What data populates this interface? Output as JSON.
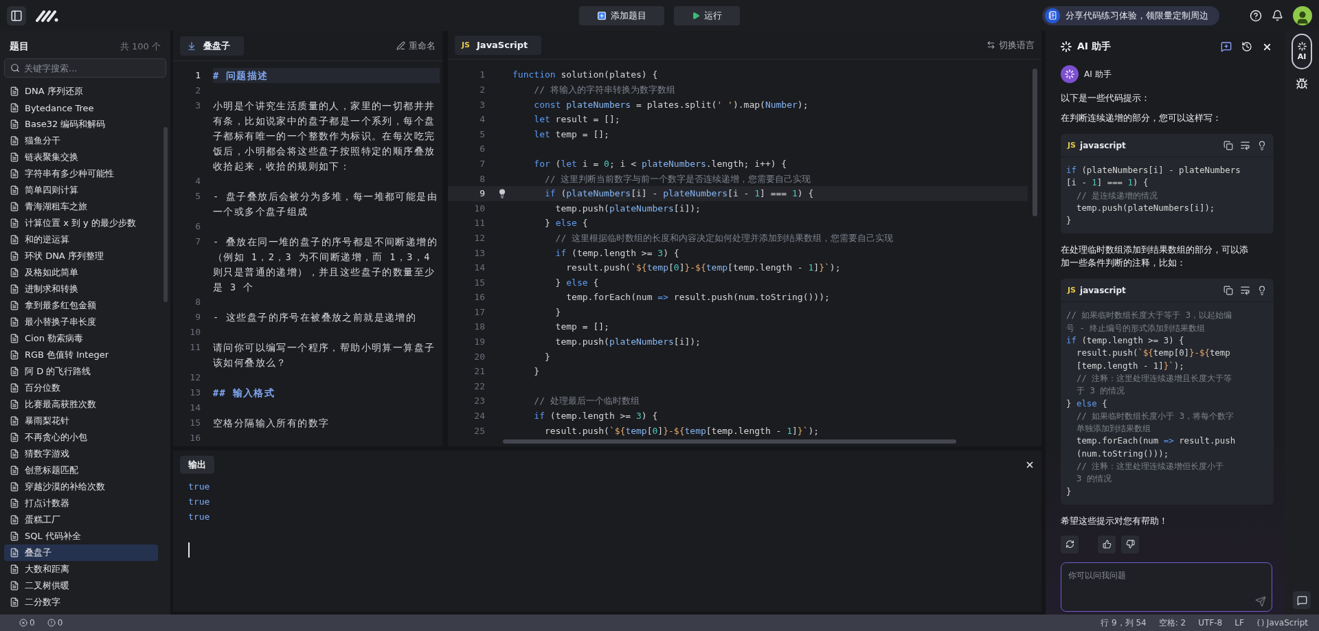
{
  "topbar": {
    "add_button": "添加题目",
    "run_button": "运行",
    "promo": "分享代码练习体验，领限量定制周边"
  },
  "sidebar": {
    "title": "题目",
    "count": "共 100 个",
    "search": {
      "placeholder": "关键字搜索..."
    },
    "items": [
      {
        "label": "DNA 序列还原",
        "selected": false
      },
      {
        "label": "Bytedance Tree",
        "selected": false
      },
      {
        "label": "Base32 编码和解码",
        "selected": false
      },
      {
        "label": "猫鱼分干",
        "selected": false
      },
      {
        "label": "链表聚集交换",
        "selected": false
      },
      {
        "label": "字符串有多少种可能性",
        "selected": false
      },
      {
        "label": "简单四则计算",
        "selected": false
      },
      {
        "label": "青海湖租车之旅",
        "selected": false
      },
      {
        "label": "计算位置 x 到 y 的最少步数",
        "selected": false
      },
      {
        "label": "和的逆运算",
        "selected": false
      },
      {
        "label": "环状 DNA 序列整理",
        "selected": false
      },
      {
        "label": "及格如此简单",
        "selected": false
      },
      {
        "label": "进制求和转换",
        "selected": false
      },
      {
        "label": "拿到最多红包金额",
        "selected": false
      },
      {
        "label": "最小替换子串长度",
        "selected": false
      },
      {
        "label": "Cion 勒索病毒",
        "selected": false
      },
      {
        "label": "RGB 色值转 Integer",
        "selected": false
      },
      {
        "label": "阿 D 的飞行路线",
        "selected": false
      },
      {
        "label": "百分位数",
        "selected": false
      },
      {
        "label": "比赛最高获胜次数",
        "selected": false
      },
      {
        "label": "暴雨梨花针",
        "selected": false
      },
      {
        "label": "不再贪心的小包",
        "selected": false
      },
      {
        "label": "猜数字游戏",
        "selected": false
      },
      {
        "label": "创意标题匹配",
        "selected": false
      },
      {
        "label": "穿越沙漠的补给次数",
        "selected": false
      },
      {
        "label": "打点计数器",
        "selected": false
      },
      {
        "label": "蛋糕工厂",
        "selected": false
      },
      {
        "label": "SQL 代码补全",
        "selected": false
      },
      {
        "label": "叠盘子",
        "selected": true
      },
      {
        "label": "大数和距离",
        "selected": false
      },
      {
        "label": "二叉树供暖",
        "selected": false
      },
      {
        "label": "二分数字",
        "selected": false
      }
    ]
  },
  "problem": {
    "title": "叠盘子",
    "rename": "重命名",
    "lines": [
      {
        "number": "1",
        "kind": "heading",
        "current": true,
        "rows": [
          "# 问题描述"
        ]
      },
      {
        "number": "2",
        "kind": "blank",
        "current": false
      },
      {
        "number": "3",
        "kind": "text",
        "current": false,
        "rows": [
          "小明是个讲究生活质量的人，家里的一切都井井",
          "有条，比如说家中的盘子都是一个系列，每个盘",
          "子都标有唯一的一个整数作为标识。在每次吃完",
          "饭后，小明都会将这些盘子按照特定的顺序叠放",
          "收拾起来，收拾的规则如下："
        ]
      },
      {
        "number": "4",
        "kind": "blank",
        "current": false
      },
      {
        "number": "5",
        "kind": "text",
        "current": false,
        "rows": [
          "- 盘子叠放后会被分为多堆，每一堆都可能是由",
          "一个或多个盘子组成"
        ]
      },
      {
        "number": "6",
        "kind": "blank",
        "current": false
      },
      {
        "number": "7",
        "kind": "text",
        "current": false,
        "rows": [
          "- 叠放在同一堆的盘子的序号都是不间断递增的",
          "（例如 1，2，3 为不间断递增，而 1，3，4",
          "则只是普通的递增），并且这些盘子的数量至少",
          "是 3 个"
        ]
      },
      {
        "number": "8",
        "kind": "blank",
        "current": false
      },
      {
        "number": "9",
        "kind": "text",
        "current": false,
        "rows": [
          "- 这些盘子的序号在被叠放之前就是递增的"
        ]
      },
      {
        "number": "10",
        "kind": "blank",
        "current": false
      },
      {
        "number": "11",
        "kind": "text",
        "current": false,
        "rows": [
          "请问你可以编写一个程序，帮助小明算一算盘子",
          "该如何叠放么？"
        ]
      },
      {
        "number": "12",
        "kind": "blank",
        "current": false
      },
      {
        "number": "13",
        "kind": "heading",
        "current": false,
        "rows": [
          "## 输入格式"
        ]
      },
      {
        "number": "14",
        "kind": "blank",
        "current": false
      },
      {
        "number": "15",
        "kind": "text",
        "current": false,
        "rows": [
          "空格分隔输入所有的数字"
        ]
      },
      {
        "number": "16",
        "kind": "blank",
        "current": false
      }
    ]
  },
  "editor": {
    "badge": "JS",
    "language": "JavaScript",
    "switch": "切换语言",
    "lines": [
      {
        "number": "1",
        "current": false,
        "tokens": [
          {
            "kind": "k",
            "text": "function"
          },
          {
            "kind": "p",
            "text": " solution(plates) {"
          }
        ]
      },
      {
        "number": "2",
        "current": false,
        "tokens": [
          {
            "kind": "c",
            "text": "    // 将输入的字符串转换为数字数组"
          }
        ]
      },
      {
        "number": "3",
        "current": false,
        "tokens": [
          {
            "kind": "k",
            "text": "    const"
          },
          {
            "kind": "v",
            "text": " plateNumbers"
          },
          {
            "kind": "p",
            "text": " = plates.split("
          },
          {
            "kind": "s",
            "text": "' '"
          },
          {
            "kind": "p",
            "text": ").map("
          },
          {
            "kind": "v",
            "text": "Number"
          },
          {
            "kind": "p",
            "text": ");"
          }
        ]
      },
      {
        "number": "4",
        "current": false,
        "tokens": [
          {
            "kind": "k",
            "text": "    let"
          },
          {
            "kind": "p",
            "text": " result = [];"
          }
        ]
      },
      {
        "number": "5",
        "current": false,
        "tokens": [
          {
            "kind": "k",
            "text": "    let"
          },
          {
            "kind": "p",
            "text": " temp = [];"
          }
        ]
      },
      {
        "number": "6",
        "current": false
      },
      {
        "number": "7",
        "current": false,
        "tokens": [
          {
            "kind": "k",
            "text": "    for"
          },
          {
            "kind": "p",
            "text": " ("
          },
          {
            "kind": "k",
            "text": "let"
          },
          {
            "kind": "p",
            "text": " i = "
          },
          {
            "kind": "n",
            "text": "0"
          },
          {
            "kind": "p",
            "text": "; i < "
          },
          {
            "kind": "v",
            "text": "plateNumbers"
          },
          {
            "kind": "p",
            "text": ".length; i++) {"
          }
        ]
      },
      {
        "number": "8",
        "current": false,
        "tokens": [
          {
            "kind": "c",
            "text": "      // 这里判断当前数字与前一个数字是否连续递增，您需要自己实现"
          }
        ]
      },
      {
        "number": "9",
        "current": true,
        "tokens": [
          {
            "kind": "k",
            "text": "      if"
          },
          {
            "kind": "p",
            "text": " ("
          },
          {
            "kind": "v",
            "text": "plateNumbers"
          },
          {
            "kind": "p",
            "text": "[i] - "
          },
          {
            "kind": "v",
            "text": "plateNumbers"
          },
          {
            "kind": "p",
            "text": "[i - "
          },
          {
            "kind": "n",
            "text": "1"
          },
          {
            "kind": "p",
            "text": "] === "
          },
          {
            "kind": "n",
            "text": "1"
          },
          {
            "kind": "p",
            "text": ") {"
          }
        ]
      },
      {
        "number": "10",
        "current": false,
        "tokens": [
          {
            "kind": "p",
            "text": "        temp.push("
          },
          {
            "kind": "v",
            "text": "plateNumbers"
          },
          {
            "kind": "p",
            "text": "[i]);"
          }
        ]
      },
      {
        "number": "11",
        "current": false,
        "tokens": [
          {
            "kind": "p",
            "text": "      } "
          },
          {
            "kind": "k",
            "text": "else"
          },
          {
            "kind": "p",
            "text": " {"
          }
        ]
      },
      {
        "number": "12",
        "current": false,
        "tokens": [
          {
            "kind": "c",
            "text": "        // 这里根据临时数组的长度和内容决定如何处理并添加到结果数组，您需要自己实现"
          }
        ]
      },
      {
        "number": "13",
        "current": false,
        "tokens": [
          {
            "kind": "k",
            "text": "        if"
          },
          {
            "kind": "p",
            "text": " (temp.length >= "
          },
          {
            "kind": "n",
            "text": "3"
          },
          {
            "kind": "p",
            "text": ") {"
          }
        ]
      },
      {
        "number": "14",
        "current": false,
        "tokens": [
          {
            "kind": "p",
            "text": "          result.push("
          },
          {
            "kind": "s",
            "text": "`${"
          },
          {
            "kind": "v",
            "text": "temp"
          },
          {
            "kind": "p",
            "text": "["
          },
          {
            "kind": "n",
            "text": "0"
          },
          {
            "kind": "p",
            "text": "]"
          },
          {
            "kind": "s",
            "text": "}-${"
          },
          {
            "kind": "v",
            "text": "temp"
          },
          {
            "kind": "p",
            "text": "[temp.length - "
          },
          {
            "kind": "n",
            "text": "1"
          },
          {
            "kind": "p",
            "text": "]"
          },
          {
            "kind": "s",
            "text": "}`"
          },
          {
            "kind": "p",
            "text": ");"
          }
        ]
      },
      {
        "number": "15",
        "current": false,
        "tokens": [
          {
            "kind": "p",
            "text": "        } "
          },
          {
            "kind": "k",
            "text": "else"
          },
          {
            "kind": "p",
            "text": " {"
          }
        ]
      },
      {
        "number": "16",
        "current": false,
        "tokens": [
          {
            "kind": "p",
            "text": "          temp.forEach(num "
          },
          {
            "kind": "k",
            "text": "=>"
          },
          {
            "kind": "p",
            "text": " result.push(num.toString()));"
          }
        ]
      },
      {
        "number": "17",
        "current": false,
        "tokens": [
          {
            "kind": "p",
            "text": "        }"
          }
        ]
      },
      {
        "number": "18",
        "current": false,
        "tokens": [
          {
            "kind": "p",
            "text": "        temp = [];"
          }
        ]
      },
      {
        "number": "19",
        "current": false,
        "tokens": [
          {
            "kind": "p",
            "text": "        temp.push("
          },
          {
            "kind": "v",
            "text": "plateNumbers"
          },
          {
            "kind": "p",
            "text": "[i]);"
          }
        ]
      },
      {
        "number": "20",
        "current": false,
        "tokens": [
          {
            "kind": "p",
            "text": "      }"
          }
        ]
      },
      {
        "number": "21",
        "current": false,
        "tokens": [
          {
            "kind": "p",
            "text": "    }"
          }
        ]
      },
      {
        "number": "22",
        "current": false
      },
      {
        "number": "23",
        "current": false,
        "tokens": [
          {
            "kind": "c",
            "text": "    // 处理最后一个临时数组"
          }
        ]
      },
      {
        "number": "24",
        "current": false,
        "tokens": [
          {
            "kind": "k",
            "text": "    if"
          },
          {
            "kind": "p",
            "text": " (temp.length >= "
          },
          {
            "kind": "n",
            "text": "3"
          },
          {
            "kind": "p",
            "text": ") {"
          }
        ]
      },
      {
        "number": "25",
        "current": false,
        "tokens": [
          {
            "kind": "p",
            "text": "      result.push("
          },
          {
            "kind": "s",
            "text": "`${"
          },
          {
            "kind": "v",
            "text": "temp"
          },
          {
            "kind": "p",
            "text": "["
          },
          {
            "kind": "n",
            "text": "0"
          },
          {
            "kind": "p",
            "text": "]"
          },
          {
            "kind": "s",
            "text": "}-${"
          },
          {
            "kind": "v",
            "text": "temp"
          },
          {
            "kind": "p",
            "text": "[temp.length - "
          },
          {
            "kind": "n",
            "text": "1"
          },
          {
            "kind": "p",
            "text": "]"
          },
          {
            "kind": "s",
            "text": "}`"
          },
          {
            "kind": "p",
            "text": ");"
          }
        ]
      }
    ]
  },
  "output": {
    "tab": "输出",
    "lines": [
      "true",
      "true",
      "true"
    ]
  },
  "assistant": {
    "title": "AI 助手",
    "sender": "AI 助手",
    "blocks": [
      {
        "kind": "text",
        "text": "以下是一些代码提示："
      },
      {
        "kind": "text",
        "text": "在判断连续递增的部分，您可以这样写："
      },
      {
        "kind": "code",
        "badge": "JS",
        "language": "javascript",
        "lines": [
          [
            {
              "kind": "k",
              "text": "if"
            },
            {
              "kind": "p",
              "text": " (plateNumbers[i] - plateNumbers"
            }
          ],
          [
            {
              "kind": "p",
              "text": "[i - "
            },
            {
              "kind": "n",
              "text": "1"
            },
            {
              "kind": "p",
              "text": "] === "
            },
            {
              "kind": "n",
              "text": "1"
            },
            {
              "kind": "p",
              "text": ") {"
            }
          ],
          [
            {
              "kind": "c",
              "text": "  // 是连续递增的情况"
            }
          ],
          [
            {
              "kind": "p",
              "text": "  temp.push(plateNumbers[i]);"
            }
          ],
          [
            {
              "kind": "p",
              "text": "}"
            }
          ]
        ]
      },
      {
        "kind": "text",
        "text": "在处理临时数组添加到结果数组的部分，可以添加一些条件判断的注释，比如："
      },
      {
        "kind": "code",
        "badge": "JS",
        "language": "javascript",
        "lines": [
          [
            {
              "kind": "c",
              "text": "// 如果临时数组长度大于等于 3，以起始编"
            }
          ],
          [
            {
              "kind": "c",
              "text": "号 - 终止编号的形式添加到结果数组"
            }
          ],
          [
            {
              "kind": "k",
              "text": "if"
            },
            {
              "kind": "p",
              "text": " (temp.length >= 3) {"
            }
          ],
          [
            {
              "kind": "p",
              "text": "  result.push("
            },
            {
              "kind": "s",
              "text": "`${"
            },
            {
              "kind": "p",
              "text": "temp[0]"
            },
            {
              "kind": "s",
              "text": "}-${"
            },
            {
              "kind": "p",
              "text": "temp"
            }
          ],
          [
            {
              "kind": "p",
              "text": "  [temp.length - 1]"
            },
            {
              "kind": "s",
              "text": "}`"
            },
            {
              "kind": "p",
              "text": ");"
            }
          ],
          [
            {
              "kind": "c",
              "text": "  // 注释：这里处理连续递增且长度大于等"
            }
          ],
          [
            {
              "kind": "c",
              "text": "  于 3 的情况"
            }
          ],
          [
            {
              "kind": "p",
              "text": "} "
            },
            {
              "kind": "k",
              "text": "else"
            },
            {
              "kind": "p",
              "text": " {"
            }
          ],
          [
            {
              "kind": "c",
              "text": "  // 如果临时数组长度小于 3，将每个数字"
            }
          ],
          [
            {
              "kind": "c",
              "text": "  单独添加到结果数组"
            }
          ],
          [
            {
              "kind": "p",
              "text": "  temp.forEach(num "
            },
            {
              "kind": "k",
              "text": "=>"
            },
            {
              "kind": "p",
              "text": " result.push"
            }
          ],
          [
            {
              "kind": "p",
              "text": "  (num.toString()));"
            }
          ],
          [
            {
              "kind": "c",
              "text": "  // 注释：这里处理连续递增但长度小于"
            }
          ],
          [
            {
              "kind": "c",
              "text": "  3 的情况"
            }
          ],
          [
            {
              "kind": "p",
              "text": "}"
            }
          ]
        ]
      },
      {
        "kind": "text",
        "text": "希望这些提示对您有帮助！"
      }
    ],
    "input": {
      "placeholder": "你可以问我问题"
    }
  },
  "rail": {
    "ai_button": {
      "label": "AI",
      "selected": true
    }
  },
  "status": {
    "errors": "0",
    "warnings": "0",
    "position": "行 9，列 54",
    "indent": "空格: 2",
    "encoding": "UTF-8",
    "eol": "LF",
    "language": "JavaScript"
  }
}
